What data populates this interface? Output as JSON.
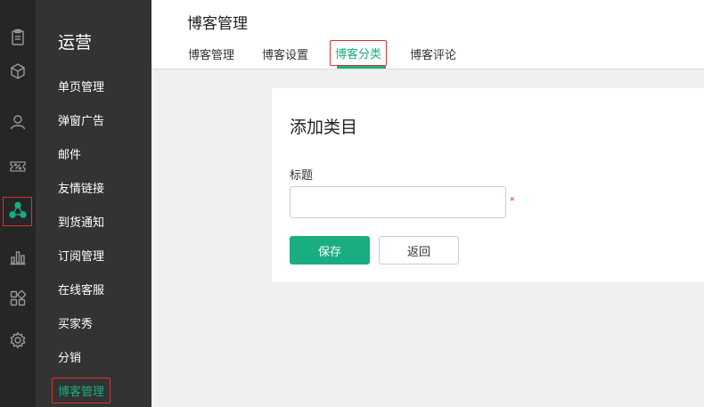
{
  "rail": {
    "items": [
      {
        "icon": "clipboard-icon"
      },
      {
        "icon": "cube-icon"
      },
      {
        "icon": "user-icon"
      },
      {
        "icon": "coupon-icon"
      },
      {
        "icon": "network-icon",
        "active": true
      },
      {
        "icon": "bar-chart-icon"
      },
      {
        "icon": "apps-icon"
      },
      {
        "icon": "gear-icon"
      }
    ],
    "accent_color": "#1aad82",
    "highlight_color": "#e0302f"
  },
  "sidebar": {
    "title": "运营",
    "items": [
      {
        "label": "单页管理"
      },
      {
        "label": "弹窗广告"
      },
      {
        "label": "邮件"
      },
      {
        "label": "友情链接"
      },
      {
        "label": "到货通知"
      },
      {
        "label": "订阅管理"
      },
      {
        "label": "在线客服"
      },
      {
        "label": "买家秀"
      },
      {
        "label": "分销"
      },
      {
        "label": "博客管理",
        "active": true
      }
    ]
  },
  "header": {
    "title": "博客管理",
    "tabs": [
      {
        "label": "博客管理"
      },
      {
        "label": "博客设置"
      },
      {
        "label": "博客分类",
        "active": true
      },
      {
        "label": "博客评论"
      }
    ]
  },
  "form": {
    "heading": "添加类目",
    "title_label": "标题",
    "title_value": "",
    "required_mark": "*",
    "save_label": "保存",
    "back_label": "返回"
  }
}
